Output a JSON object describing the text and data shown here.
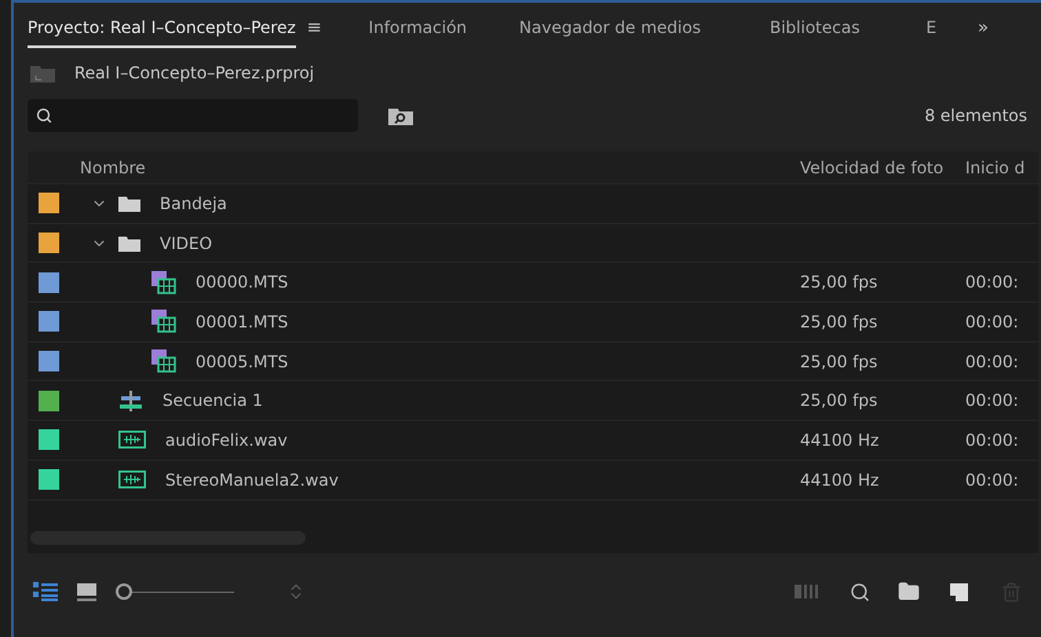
{
  "tabs": [
    {
      "label": "Proyecto: Real I–Concepto–Perez",
      "selected": true,
      "menu": "≡"
    },
    {
      "label": "Información",
      "selected": false
    },
    {
      "label": "Navegador de medios",
      "selected": false
    },
    {
      "label": "Bibliotecas",
      "selected": false
    },
    {
      "label": "E",
      "selected": false
    }
  ],
  "overflow": "»",
  "project": {
    "file": "Real I–Concepto–Perez.prproj"
  },
  "search": {
    "count": "8 elementos"
  },
  "table": {
    "columns": [
      "Nombre",
      "Velocidad de foto",
      "Inicio d"
    ],
    "rows": [
      {
        "kind": "folder",
        "name": "Bandeja",
        "color": "#e8a33c",
        "expanded": true
      },
      {
        "kind": "folder",
        "name": "VIDEO",
        "color": "#e8a33c",
        "expanded": true,
        "children": [
          {
            "kind": "clip",
            "name": "00000.MTS",
            "color": "#6f9ad6",
            "rate": "25,00 fps",
            "start": "00:00:"
          },
          {
            "kind": "clip",
            "name": "00001.MTS",
            "color": "#6f9ad6",
            "rate": "25,00 fps",
            "start": "00:00:"
          },
          {
            "kind": "clip",
            "name": "00005.MTS",
            "color": "#6f9ad6",
            "rate": "25,00 fps",
            "start": "00:00:"
          }
        ]
      },
      {
        "kind": "sequence",
        "name": "Secuencia 1",
        "color": "#52b04f",
        "rate": "25,00 fps",
        "start": "00:00:"
      },
      {
        "kind": "audio",
        "name": "audioFelix.wav",
        "color": "#34d49c",
        "rate": "44100 Hz",
        "start": "00:00:"
      },
      {
        "kind": "audio",
        "name": "StereoManuela2.wav",
        "color": "#34d49c",
        "rate": "44100 Hz",
        "start": "00:00:"
      }
    ]
  },
  "footer": {
    "list_view_selected": true,
    "zoom": {
      "level": 0
    },
    "trash_disabled": true
  }
}
